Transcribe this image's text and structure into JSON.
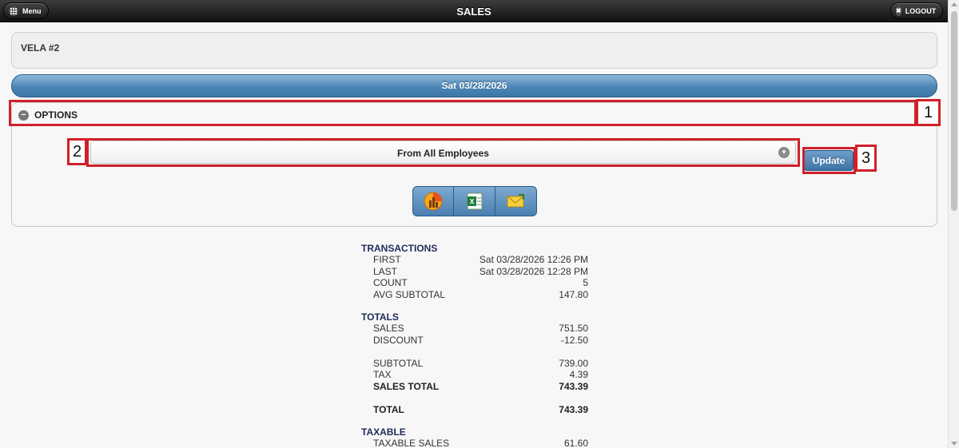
{
  "header": {
    "title": "SALES",
    "menu_label": "Menu",
    "logout_label": "LOGOUT"
  },
  "store": {
    "name": "VELA #2"
  },
  "date_label": "Sat 03/28/2026",
  "options": {
    "label": "OPTIONS",
    "employee_select": "From All Employees",
    "update_label": "Update"
  },
  "annotations": [
    "1",
    "2",
    "3"
  ],
  "report": {
    "transactions": {
      "heading": "TRANSACTIONS",
      "rows": [
        {
          "label": "FIRST",
          "value": "Sat 03/28/2026 12:26 PM"
        },
        {
          "label": "LAST",
          "value": "Sat 03/28/2026 12:28 PM"
        },
        {
          "label": "COUNT",
          "value": "5"
        },
        {
          "label": "AVG SUBTOTAL",
          "value": "147.80"
        }
      ]
    },
    "totals": {
      "heading": "TOTALS",
      "sales": {
        "label": "SALES",
        "value": "751.50"
      },
      "discount": {
        "label": "DISCOUNT",
        "value": "-12.50"
      },
      "subtotal": {
        "label": "SUBTOTAL",
        "value": "739.00"
      },
      "tax": {
        "label": "TAX",
        "value": "4.39"
      },
      "sales_total": {
        "label": "SALES TOTAL",
        "value": "743.39"
      },
      "total": {
        "label": "TOTAL",
        "value": "743.39"
      }
    },
    "taxable": {
      "heading": "TAXABLE",
      "taxable_sales": {
        "label": "TAXABLE SALES",
        "value": "61.60"
      }
    }
  },
  "icons": {
    "menu": "grid-icon",
    "logout": "close-icon",
    "options_toggle": "minus-circle-icon",
    "select_chevron": "chevron-down-icon",
    "export": [
      "chart-icon",
      "excel-icon",
      "email-icon"
    ]
  },
  "colors": {
    "accent_blue": "#4d86b5",
    "annotation_red": "#d0202a",
    "heading_navy": "#1d2b5a"
  }
}
